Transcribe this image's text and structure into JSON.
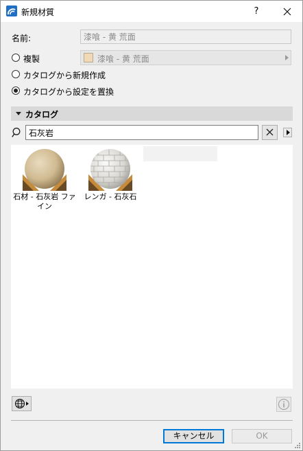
{
  "window": {
    "title": "新規材質",
    "help_label": "?"
  },
  "form": {
    "name_label": "名前:",
    "name_value": "漆喰 - 黄 荒面",
    "duplicate_label": "複製",
    "duplicate_value": "漆喰 - 黄 荒面",
    "duplicate_swatch_color": "#efd9b6",
    "radio_new_from_catalog": "カタログから新規作成",
    "radio_replace_from_catalog": "カタログから設定を置換",
    "selected_option": "カタログから設定を置換"
  },
  "catalog": {
    "title": "カタログ",
    "search_value": "石灰岩",
    "items": [
      {
        "label": "石材 - 石灰岩 ファイン",
        "icon": "sandstone-sphere-thumbnail"
      },
      {
        "label": "レンガ - 石灰石",
        "icon": "brick-sphere-thumbnail"
      }
    ]
  },
  "footer": {
    "cancel_label": "キャンセル",
    "ok_label": "OK",
    "accent": "#0078d7"
  }
}
